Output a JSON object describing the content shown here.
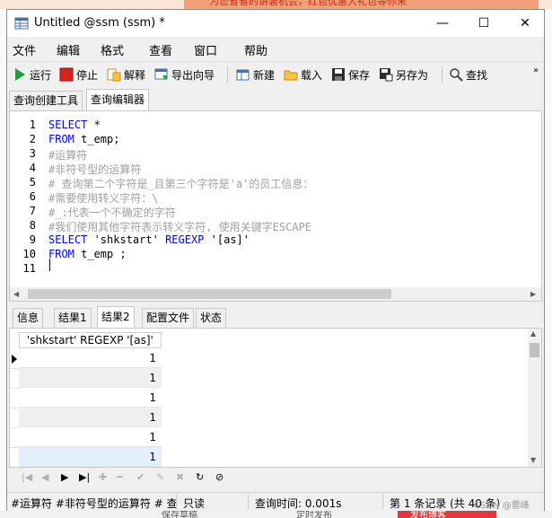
{
  "window": {
    "title": "Untitled @ssm (ssm) *",
    "minimize": "—",
    "maximize": "☐",
    "close": "✕"
  },
  "menu": [
    "文件",
    "编辑",
    "格式",
    "查看",
    "窗口",
    "帮助"
  ],
  "toolbar": {
    "run": "运行",
    "stop": "停止",
    "explain": "解释",
    "export_wizard": "导出向导",
    "new": "新建",
    "load": "载入",
    "save": "保存",
    "save_as": "另存为",
    "find": "查找"
  },
  "editor_tabs": [
    "查询创建工具",
    "查询编辑器"
  ],
  "editor": {
    "lines": [
      {
        "n": "1",
        "parts": [
          {
            "t": "SELECT",
            "c": "kw"
          },
          {
            "t": " *",
            "c": "str"
          }
        ]
      },
      {
        "n": "2",
        "parts": [
          {
            "t": "FROM",
            "c": "kw"
          },
          {
            "t": " t_emp;",
            "c": "str"
          }
        ]
      },
      {
        "n": "3",
        "parts": [
          {
            "t": "#运算符",
            "c": "cm"
          }
        ]
      },
      {
        "n": "4",
        "parts": [
          {
            "t": "#非符号型的运算符",
            "c": "cm"
          }
        ]
      },
      {
        "n": "5",
        "parts": [
          {
            "t": "# 查询第二个字符是_且第三个字符是'a'的员工信息：",
            "c": "cm"
          }
        ]
      },
      {
        "n": "6",
        "parts": [
          {
            "t": "#需要使用转义字符：\\",
            "c": "cm"
          }
        ]
      },
      {
        "n": "7",
        "parts": [
          {
            "t": "#_:代表一个不确定的字符",
            "c": "cm"
          }
        ]
      },
      {
        "n": "8",
        "parts": [
          {
            "t": "#我们使用其他字符表示转义字符, 使用关键字ESCAPE",
            "c": "cm"
          }
        ]
      },
      {
        "n": "9",
        "parts": [
          {
            "t": "SELECT",
            "c": "kw"
          },
          {
            "t": " 'shkstart' ",
            "c": "str"
          },
          {
            "t": "REGEXP",
            "c": "kw"
          },
          {
            "t": " '[as]'",
            "c": "str"
          }
        ]
      },
      {
        "n": "10",
        "parts": [
          {
            "t": "FROM",
            "c": "kw"
          },
          {
            "t": " t_emp ;",
            "c": "str"
          }
        ]
      },
      {
        "n": "11",
        "parts": []
      }
    ]
  },
  "result_tabs": [
    "信息",
    "结果1",
    "结果2",
    "配置文件",
    "状态"
  ],
  "grid": {
    "column": "'shkstart' REGEXP '[as]'",
    "rows": [
      "1",
      "1",
      "1",
      "1",
      "1",
      "1"
    ]
  },
  "statusbar": {
    "query_text": "#运算符 #非符号型的运算符 # 查",
    "readonly": "只读",
    "query_time": "查询时间: 0.001s",
    "record": "第 1 条记录 (共 40 条)",
    "watermark": "CSDN @蕾峰"
  },
  "background": {
    "top_banner": "为您省省的讲装机会，红包优惠大礼包等你来",
    "bottom_left": "保存草稿",
    "bottom_mid": "定时发布",
    "bottom_right": "发布博客"
  },
  "colors": {
    "keyword": "#0000ff",
    "comment": "#a0a0a0",
    "run_green": "#1aa33a",
    "stop_red": "#d9231b"
  }
}
